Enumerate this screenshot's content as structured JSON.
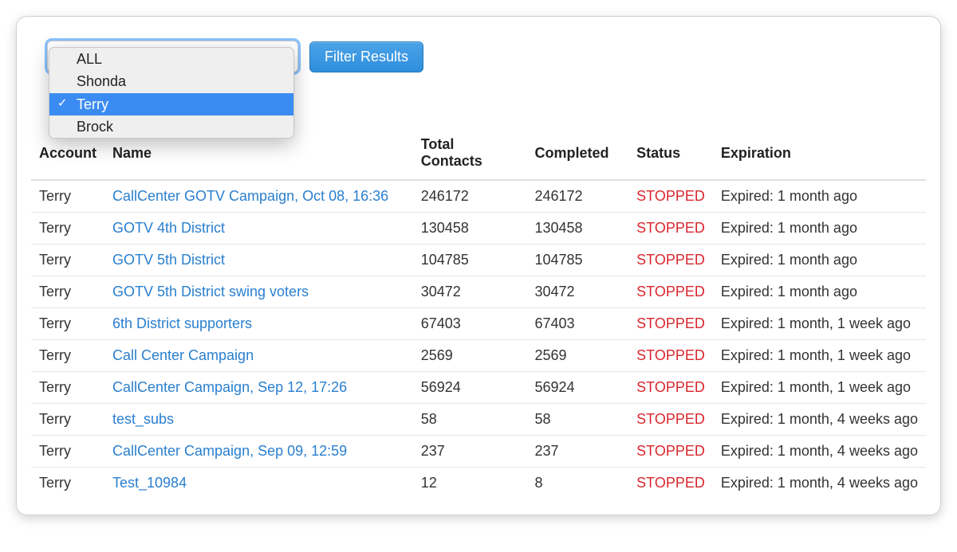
{
  "filter": {
    "button_label": "Filter Results",
    "selected_value": "Terry",
    "options": [
      {
        "label": "ALL",
        "selected": false
      },
      {
        "label": "Shonda",
        "selected": false
      },
      {
        "label": "Terry",
        "selected": true
      },
      {
        "label": "Brock",
        "selected": false
      }
    ]
  },
  "table": {
    "headers": {
      "account": "Account",
      "name": "Name",
      "total_contacts": "Total Contacts",
      "completed": "Completed",
      "status": "Status",
      "expiration": "Expiration"
    },
    "rows": [
      {
        "account": "Terry",
        "name": "CallCenter GOTV Campaign, Oct 08, 16:36",
        "total": "246172",
        "completed": "246172",
        "status": "STOPPED",
        "expiration": "Expired: 1 month ago"
      },
      {
        "account": "Terry",
        "name": "GOTV 4th District",
        "total": "130458",
        "completed": "130458",
        "status": "STOPPED",
        "expiration": "Expired: 1 month ago"
      },
      {
        "account": "Terry",
        "name": "GOTV 5th District",
        "total": "104785",
        "completed": "104785",
        "status": "STOPPED",
        "expiration": "Expired: 1 month ago"
      },
      {
        "account": "Terry",
        "name": "GOTV 5th District swing voters",
        "total": "30472",
        "completed": "30472",
        "status": "STOPPED",
        "expiration": "Expired: 1 month ago"
      },
      {
        "account": "Terry",
        "name": "6th District supporters",
        "total": "67403",
        "completed": "67403",
        "status": "STOPPED",
        "expiration": "Expired: 1 month, 1 week ago"
      },
      {
        "account": "Terry",
        "name": "Call Center Campaign",
        "total": "2569",
        "completed": "2569",
        "status": "STOPPED",
        "expiration": "Expired: 1 month, 1 week ago"
      },
      {
        "account": "Terry",
        "name": "CallCenter Campaign, Sep 12, 17:26",
        "total": "56924",
        "completed": "56924",
        "status": "STOPPED",
        "expiration": "Expired: 1 month, 1 week ago"
      },
      {
        "account": "Terry",
        "name": "test_subs",
        "total": "58",
        "completed": "58",
        "status": "STOPPED",
        "expiration": "Expired: 1 month, 4 weeks ago"
      },
      {
        "account": "Terry",
        "name": "CallCenter Campaign, Sep 09, 12:59",
        "total": "237",
        "completed": "237",
        "status": "STOPPED",
        "expiration": "Expired: 1 month, 4 weeks ago"
      },
      {
        "account": "Terry",
        "name": "Test_10984",
        "total": "12",
        "completed": "8",
        "status": "STOPPED",
        "expiration": "Expired: 1 month, 4 weeks ago"
      }
    ]
  }
}
